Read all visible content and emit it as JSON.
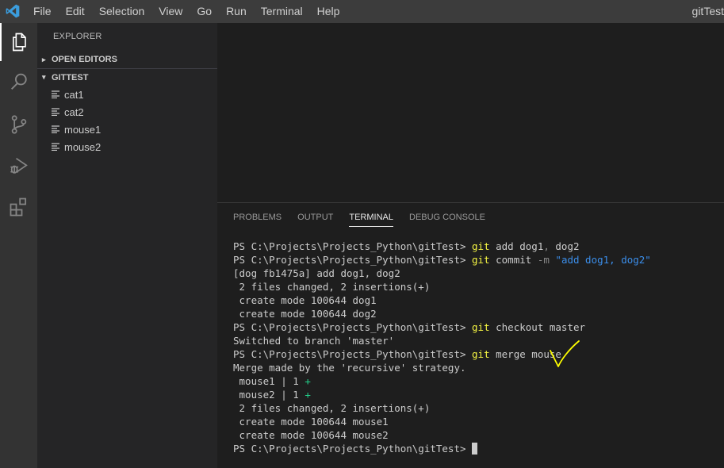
{
  "titlebar": {
    "menu": [
      "File",
      "Edit",
      "Selection",
      "View",
      "Go",
      "Run",
      "Terminal",
      "Help"
    ],
    "window_title": "gitTest"
  },
  "activitybar": {
    "icons": [
      "files-icon",
      "search-icon",
      "source-control-icon",
      "run-debug-icon",
      "extensions-icon"
    ]
  },
  "sidebar": {
    "header": "EXPLORER",
    "open_editors": "OPEN EDITORS",
    "folder": "GITTEST",
    "files": [
      "cat1",
      "cat2",
      "mouse1",
      "mouse2"
    ]
  },
  "panel": {
    "tabs": [
      "PROBLEMS",
      "OUTPUT",
      "TERMINAL",
      "DEBUG CONSOLE"
    ],
    "active_tab": "TERMINAL"
  },
  "terminal": {
    "lines": [
      {
        "type": "cmd",
        "prompt": "PS C:\\Projects\\Projects_Python\\gitTest> ",
        "git": "git",
        "args": " add dog1",
        "sep": ",",
        "args2": " dog2"
      },
      {
        "type": "commit",
        "prompt": "PS C:\\Projects\\Projects_Python\\gitTest> ",
        "git": "git",
        "args": " commit ",
        "flag": "-m",
        "str": " \"add dog1, dog2\""
      },
      {
        "type": "out",
        "text": "[dog fb1475a] add dog1, dog2"
      },
      {
        "type": "out",
        "text": " 2 files changed, 2 insertions(+)"
      },
      {
        "type": "out",
        "text": " create mode 100644 dog1"
      },
      {
        "type": "out",
        "text": " create mode 100644 dog2"
      },
      {
        "type": "cmd",
        "prompt": "PS C:\\Projects\\Projects_Python\\gitTest> ",
        "git": "git",
        "args": " checkout master"
      },
      {
        "type": "out",
        "text": "Switched to branch 'master'"
      },
      {
        "type": "cmd",
        "prompt": "PS C:\\Projects\\Projects_Python\\gitTest> ",
        "git": "git",
        "args": " merge mouse"
      },
      {
        "type": "out",
        "text": "Merge made by the 'recursive' strategy."
      },
      {
        "type": "stat",
        "text": " mouse1 | 1 ",
        "plus": "+"
      },
      {
        "type": "stat",
        "text": " mouse2 | 1 ",
        "plus": "+"
      },
      {
        "type": "out",
        "text": " 2 files changed, 2 insertions(+)"
      },
      {
        "type": "out",
        "text": " create mode 100644 mouse1"
      },
      {
        "type": "out",
        "text": " create mode 100644 mouse2"
      },
      {
        "type": "prompt",
        "prompt": "PS C:\\Projects\\Projects_Python\\gitTest> "
      }
    ]
  },
  "colors": {
    "accent_vscode": "#3b9ddd",
    "git_keyword": "#f5f543",
    "string": "#3b8eea",
    "insertion": "#23d18b",
    "annotation": "#ffff00"
  }
}
